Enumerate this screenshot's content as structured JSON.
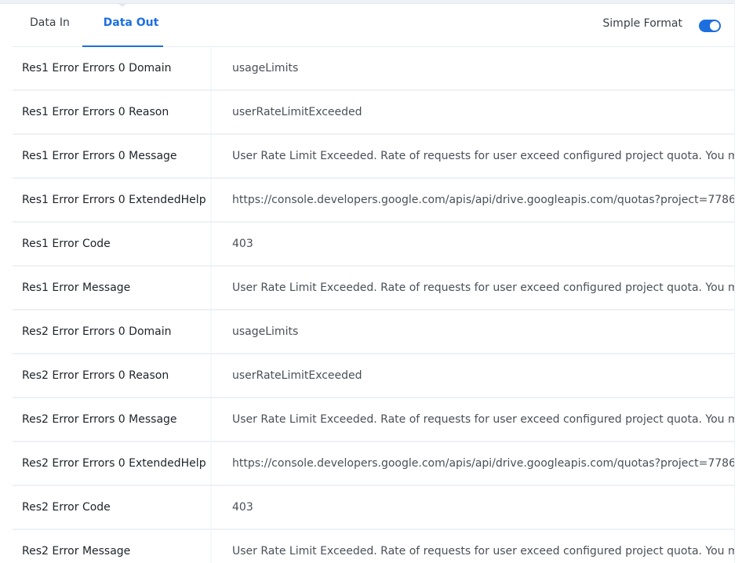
{
  "tabs": {
    "data_in": "Data In",
    "data_out": "Data Out"
  },
  "simple_format": {
    "label": "Simple Format",
    "enabled": true
  },
  "colors": {
    "accent": "#1d6fe0",
    "key_text": "#1e2228",
    "value_text": "#4a4f57"
  },
  "rows": [
    {
      "key": "Res1 Error Errors 0 Domain",
      "value": "usageLimits"
    },
    {
      "key": "Res1 Error Errors 0 Reason",
      "value": "userRateLimitExceeded"
    },
    {
      "key": "Res1 Error Errors 0 Message",
      "value": "User Rate Limit Exceeded. Rate of requests for user exceed configured project quota. You may"
    },
    {
      "key": "Res1 Error Errors 0 ExtendedHelp",
      "value": "https://console.developers.google.com/apis/api/drive.googleapis.com/quotas?project=7786"
    },
    {
      "key": "Res1 Error Code",
      "value": "403"
    },
    {
      "key": "Res1 Error Message",
      "value": "User Rate Limit Exceeded. Rate of requests for user exceed configured project quota. You may"
    },
    {
      "key": "Res2 Error Errors 0 Domain",
      "value": "usageLimits"
    },
    {
      "key": "Res2 Error Errors 0 Reason",
      "value": "userRateLimitExceeded"
    },
    {
      "key": "Res2 Error Errors 0 Message",
      "value": "User Rate Limit Exceeded. Rate of requests for user exceed configured project quota. You may"
    },
    {
      "key": "Res2 Error Errors 0 ExtendedHelp",
      "value": "https://console.developers.google.com/apis/api/drive.googleapis.com/quotas?project=7786"
    },
    {
      "key": "Res2 Error Code",
      "value": "403"
    },
    {
      "key": "Res2 Error Message",
      "value": "User Rate Limit Exceeded. Rate of requests for user exceed configured project quota. You may"
    }
  ]
}
